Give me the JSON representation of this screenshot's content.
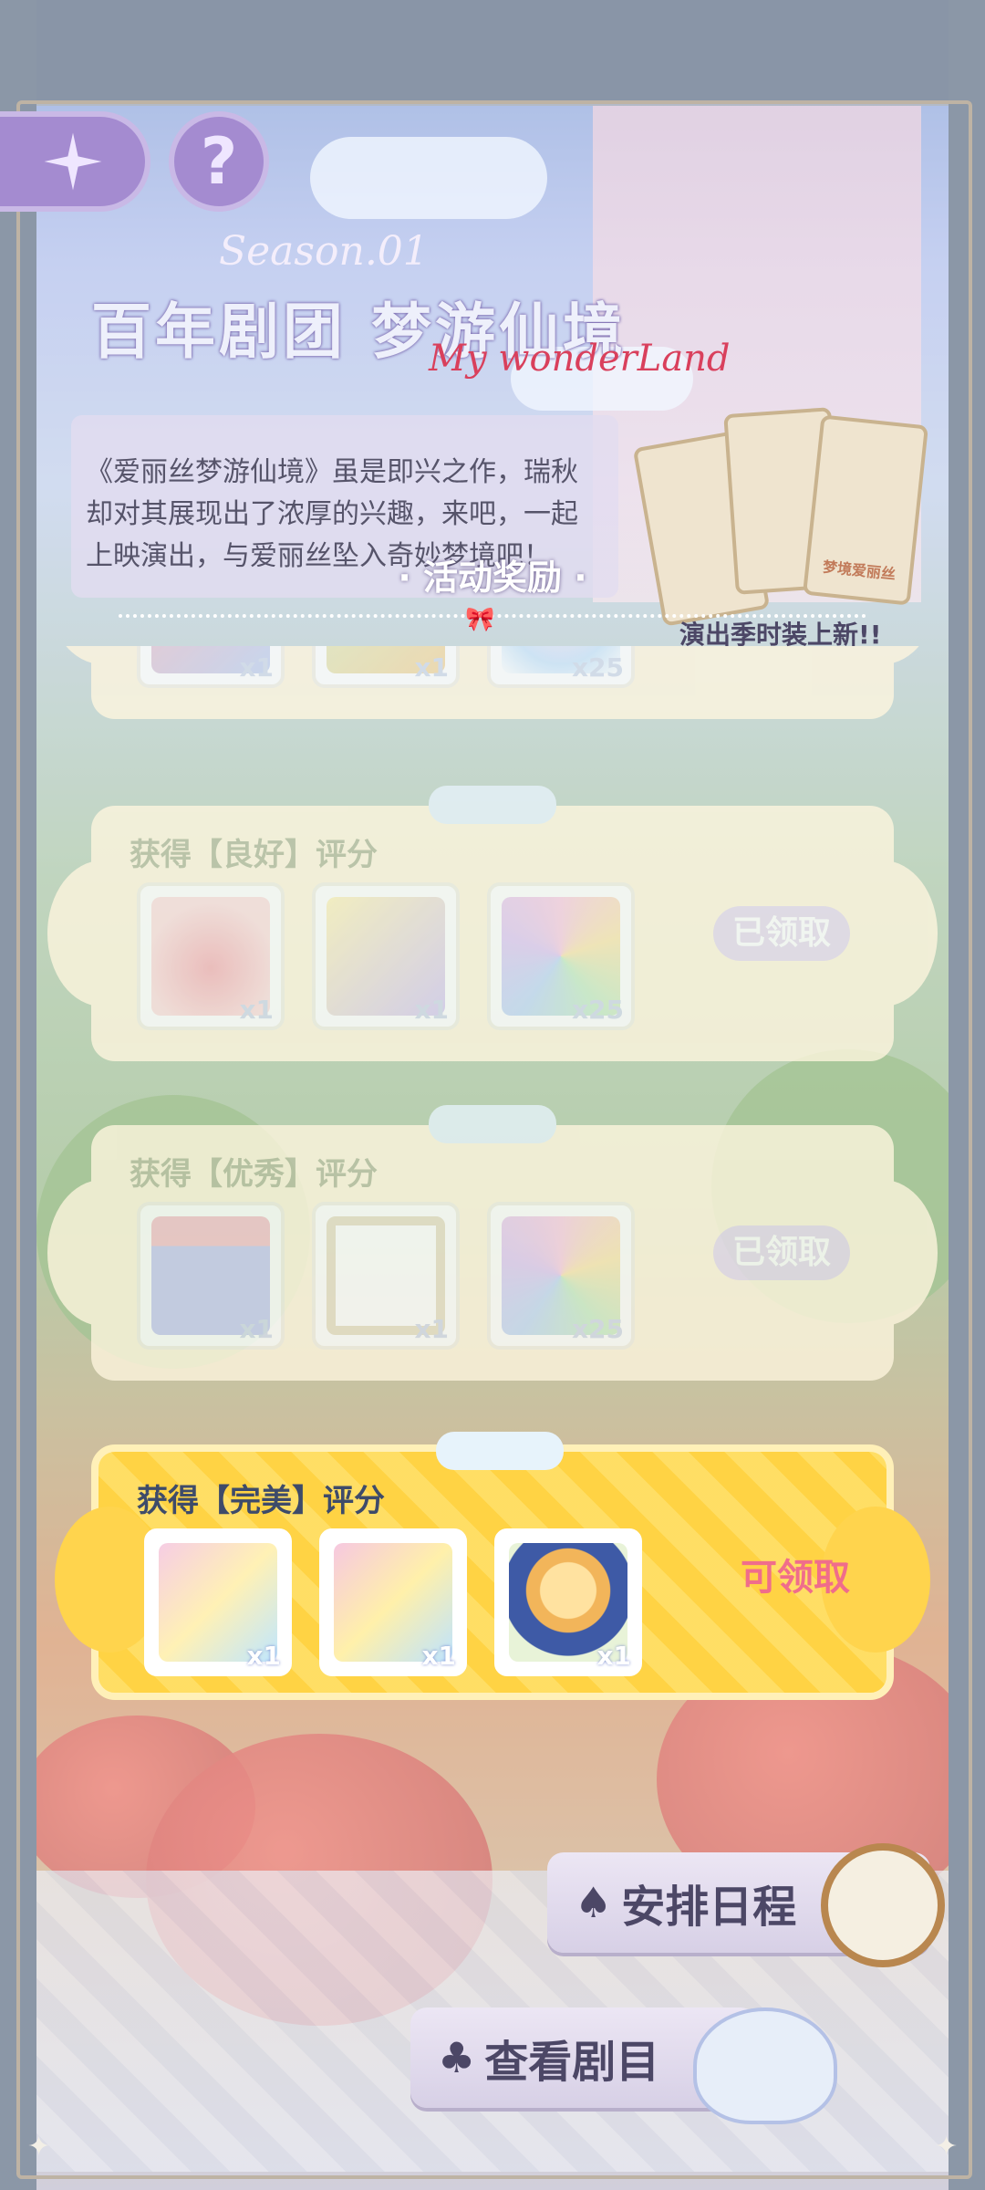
{
  "header": {
    "season": "Season.01",
    "title": "百年剧团 梦游仙境",
    "subtitle": "My wonderLand",
    "description": "《爱丽丝梦游仙境》虽是即兴之作，瑞秋却对其展现出了浓厚的兴趣，来吧，一起上映演出，与爱丽丝坠入奇妙梦境吧！",
    "stamp_caption": "演出季时装上新!!",
    "stamp_label": "梦境爱丽丝",
    "help_symbol": "?"
  },
  "section": {
    "title": "· 活动奖励 ·"
  },
  "rewards": [
    {
      "label": "",
      "status": "",
      "items": [
        {
          "qty": "x1"
        },
        {
          "qty": "x1"
        },
        {
          "qty": "x25"
        }
      ]
    },
    {
      "label": "获得【良好】评分",
      "status": "已领取",
      "items": [
        {
          "qty": "x1"
        },
        {
          "qty": "x1"
        },
        {
          "qty": "x25"
        }
      ]
    },
    {
      "label": "获得【优秀】评分",
      "status": "已领取",
      "items": [
        {
          "qty": "x1"
        },
        {
          "qty": "x1"
        },
        {
          "qty": "x25"
        }
      ]
    },
    {
      "label": "获得【完美】评分",
      "status": "可领取",
      "items": [
        {
          "qty": "x1"
        },
        {
          "qty": "x1"
        },
        {
          "qty": "x1"
        }
      ]
    }
  ],
  "buttons": {
    "schedule": "安排日程",
    "view": "查看剧目",
    "schedule_suit": "♠",
    "view_suit": "♣"
  },
  "colors": {
    "claimed_badge": "#e7dcef",
    "claimable_text": "#f06d8b",
    "gold_card": "#ffd44d",
    "card_bg": "#fff6df"
  }
}
